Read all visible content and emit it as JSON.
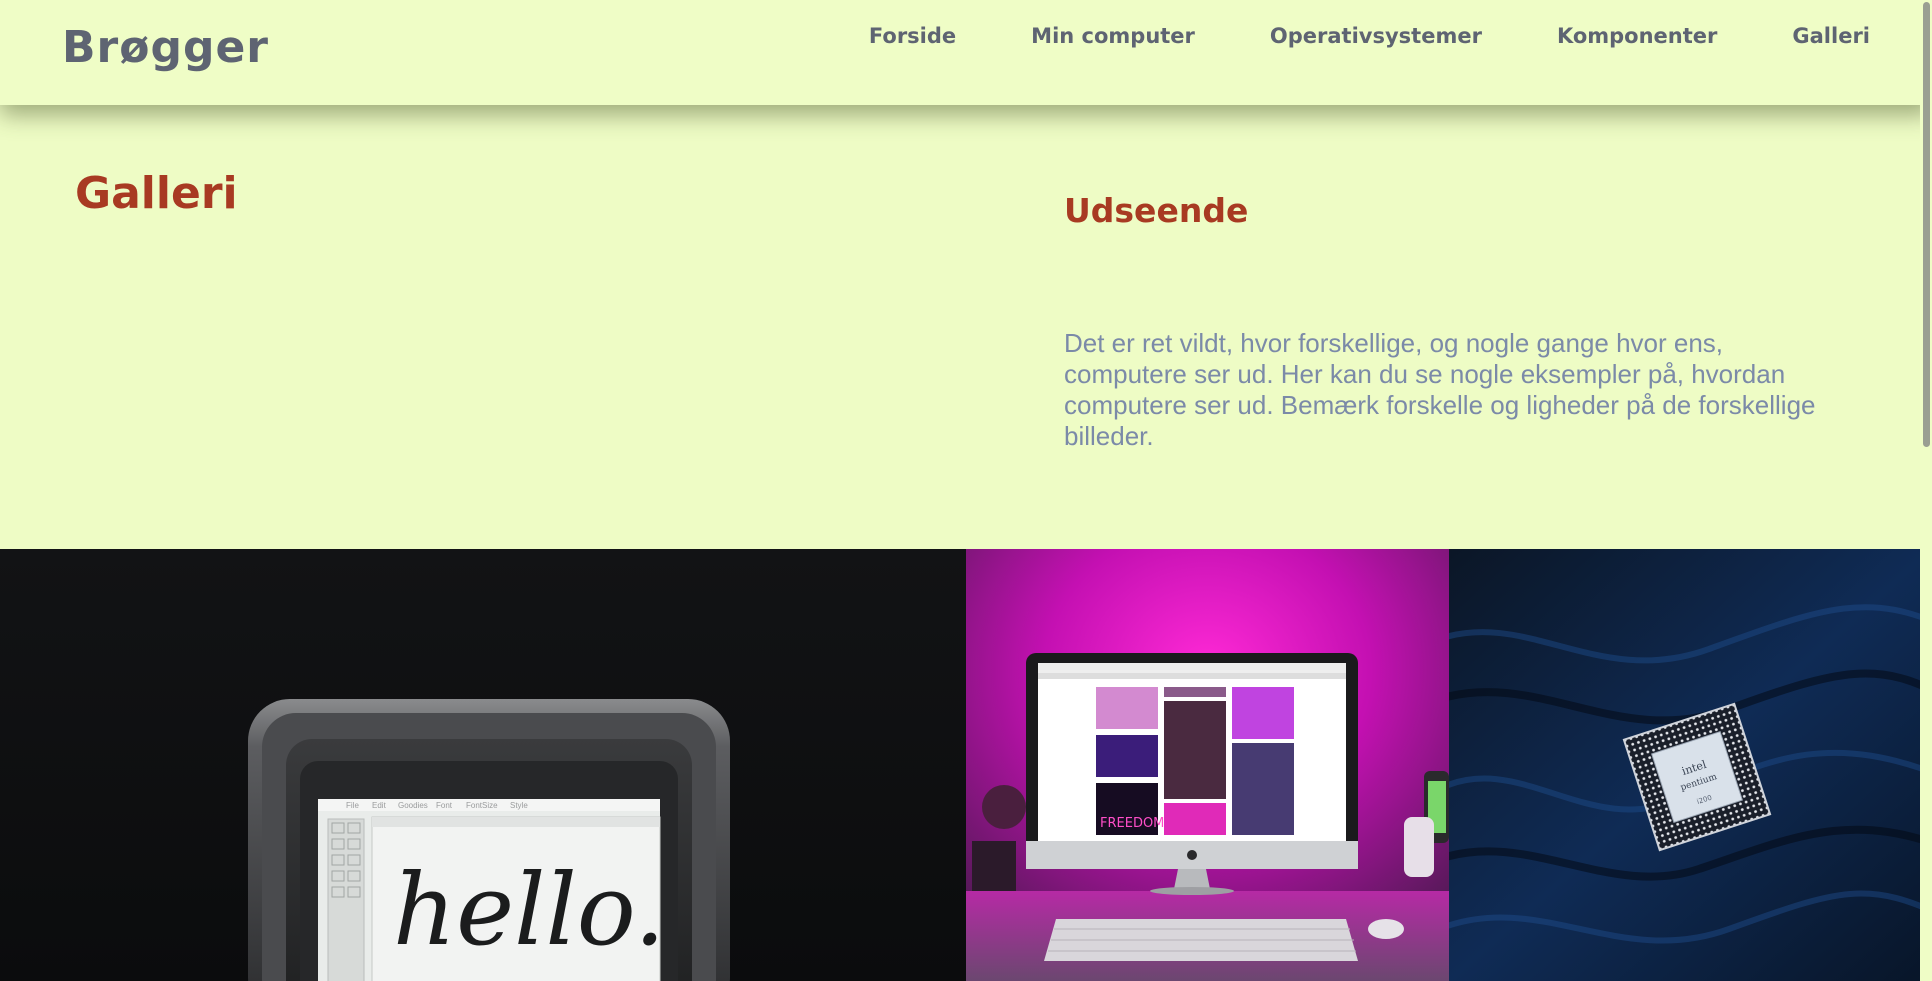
{
  "header": {
    "logo": "Brøgger",
    "nav": [
      "Forside",
      "Min computer",
      "Operativsystemer",
      "Komponenter",
      "Galleri"
    ]
  },
  "main": {
    "title": "Galleri",
    "section_title": "Udseende",
    "intro": "Det er ret vildt, hvor forskellige, og nogle gange hvor ens, computere ser ud. Her kan du se nogle eksempler på, hvordan computere ser ud. Bemærk forskelle og ligheder på de forskellige billeder."
  },
  "gallery": {
    "images": [
      {
        "subject": "vintage-computer-hello",
        "screen_text": "hello."
      },
      {
        "subject": "imac-pink-light",
        "screen_text": "FREEDOM"
      },
      {
        "subject": "intel-pentium-cpu",
        "screen_text": "intel pentium"
      }
    ]
  },
  "colors": {
    "background": "#eefcc5",
    "heading": "#a83a22",
    "nav_text": "#5e6472",
    "body_text": "#7b8aa8"
  }
}
